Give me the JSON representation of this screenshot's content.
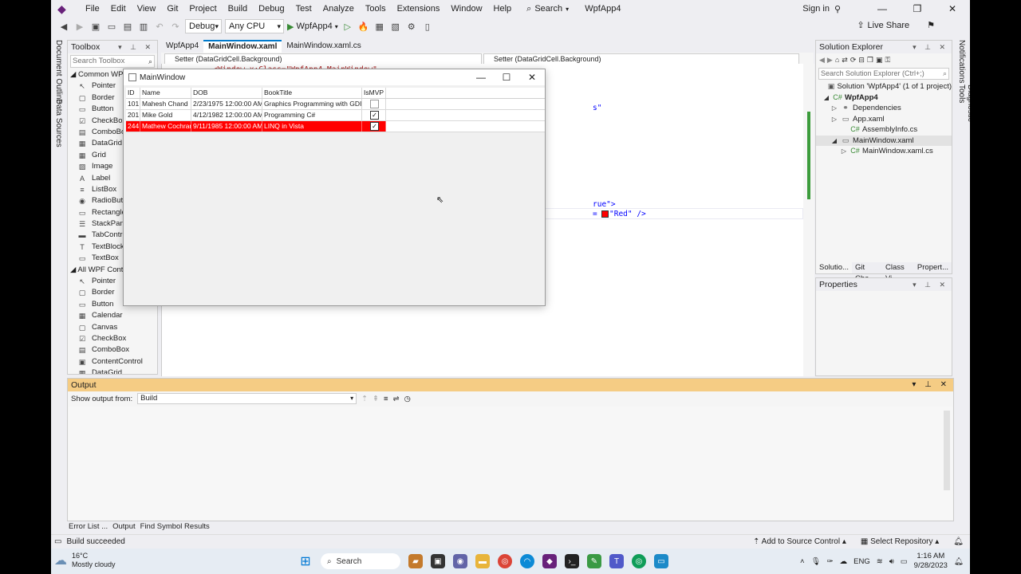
{
  "menu": {
    "items": [
      "File",
      "Edit",
      "View",
      "Git",
      "Project",
      "Build",
      "Debug",
      "Test",
      "Analyze",
      "Tools",
      "Extensions",
      "Window",
      "Help"
    ],
    "search_label": "Search",
    "solution_name": "WpfApp4",
    "sign_in": "Sign in"
  },
  "toolbar": {
    "configuration": "Debug",
    "platform": "Any CPU",
    "start_target": "WpfApp4",
    "live_share": "Live Share"
  },
  "left_strip": {
    "document_outline": "Document Outline",
    "data_sources": "Data Sources"
  },
  "toolbox": {
    "title": "Toolbox",
    "search_placeholder": "Search Toolbox",
    "group1": "Common WPF",
    "common_items": [
      {
        "label": "Pointer",
        "icon": "pointer-icon"
      },
      {
        "label": "Border",
        "icon": "border-icon"
      },
      {
        "label": "Button",
        "icon": "button-icon"
      },
      {
        "label": "CheckBox",
        "icon": "checkbox-icon"
      },
      {
        "label": "ComboBox",
        "icon": "combobox-icon"
      },
      {
        "label": "DataGrid",
        "icon": "datagrid-icon"
      },
      {
        "label": "Grid",
        "icon": "grid-icon"
      },
      {
        "label": "Image",
        "icon": "image-icon"
      },
      {
        "label": "Label",
        "icon": "label-icon"
      },
      {
        "label": "ListBox",
        "icon": "listbox-icon"
      },
      {
        "label": "RadioButt",
        "icon": "radiobutton-icon"
      },
      {
        "label": "Rectangle",
        "icon": "rectangle-icon"
      },
      {
        "label": "StackPane",
        "icon": "stackpanel-icon"
      },
      {
        "label": "TabContro",
        "icon": "tabcontrol-icon"
      },
      {
        "label": "TextBlock",
        "icon": "textblock-icon"
      },
      {
        "label": "TextBox",
        "icon": "textbox-icon"
      }
    ],
    "group2": "All WPF Control",
    "all_items": [
      {
        "label": "Pointer",
        "icon": "pointer-icon"
      },
      {
        "label": "Border",
        "icon": "border-icon"
      },
      {
        "label": "Button",
        "icon": "button-icon"
      },
      {
        "label": "Calendar",
        "icon": "calendar-icon"
      },
      {
        "label": "Canvas",
        "icon": "canvas-icon"
      },
      {
        "label": "CheckBox",
        "icon": "checkbox-icon"
      },
      {
        "label": "ComboBox",
        "icon": "combobox-icon"
      },
      {
        "label": "ContentControl",
        "icon": "contentcontrol-icon"
      },
      {
        "label": "DataGrid",
        "icon": "datagrid-icon"
      }
    ]
  },
  "editor": {
    "tabs": [
      "WpfApp4",
      "MainWindow.xaml",
      "MainWindow.xaml.cs"
    ],
    "nav_left": "Setter (DataGridCell.Background)",
    "nav_right": "Setter (DataGridCell.Background)",
    "line_top": "<Window x:Class=\"WpfApp4.MainWindow\"",
    "line_quote": "s\"",
    "line_true": "rue\">",
    "line_red_prefix": "=",
    "line_red_value": "\"Red\" />"
  },
  "wpf_window": {
    "title": "MainWindow",
    "columns": [
      "ID",
      "Name",
      "DOB",
      "BookTitle",
      "IsMVP"
    ],
    "rows": [
      {
        "id": "101",
        "name": "Mahesh Chand",
        "dob": "2/23/1975 12:00:00 AM",
        "book": "Graphics Programming with GDI+",
        "mvp": false
      },
      {
        "id": "201",
        "name": "Mike Gold",
        "dob": "4/12/1982 12:00:00 AM",
        "book": "Programming C#",
        "mvp": true
      },
      {
        "id": "244",
        "name": "Mathew Cochran",
        "dob": "9/11/1985 12:00:00 AM",
        "book": "LINQ in Vista",
        "mvp": true
      }
    ],
    "selected_row_color": "#ff0000"
  },
  "solution_explorer": {
    "title": "Solution Explorer",
    "search_placeholder": "Search Solution Explorer (Ctrl+;)",
    "nodes": [
      {
        "label": "Solution 'WpfApp4' (1 of 1 project)",
        "icon": "solution-icon"
      },
      {
        "label": "WpfApp4",
        "icon": "csharp-project-icon"
      },
      {
        "label": "Dependencies",
        "icon": "dependencies-icon"
      },
      {
        "label": "App.xaml",
        "icon": "xaml-file-icon"
      },
      {
        "label": "AssemblyInfo.cs",
        "icon": "csharp-file-icon"
      },
      {
        "label": "MainWindow.xaml",
        "icon": "xaml-file-icon"
      },
      {
        "label": "MainWindow.xaml.cs",
        "icon": "csharp-file-icon"
      }
    ],
    "tabs": [
      "Solutio...",
      "Git Cha...",
      "Class Vi...",
      "Propert..."
    ]
  },
  "properties": {
    "title": "Properties"
  },
  "right_strip": {
    "notifications": "Notifications",
    "diagnostic_tools": "Diagnostic Tools"
  },
  "output": {
    "title": "Output",
    "show_from_label": "Show output from:",
    "source": "Build"
  },
  "bottom_tabs": [
    "Error List ...",
    "Output",
    "Find Symbol Results"
  ],
  "status": {
    "message": "Build succeeded",
    "source_control": "Add to Source Control",
    "repository": "Select Repository"
  },
  "taskbar": {
    "temperature": "16°C",
    "weather": "Mostly cloudy",
    "search": "Search",
    "language": "ENG",
    "time": "1:16 AM",
    "date": "9/28/2023"
  },
  "colors": {
    "accent": "#007acc",
    "output_title": "#f5cc84",
    "selection": "#ff0000"
  }
}
